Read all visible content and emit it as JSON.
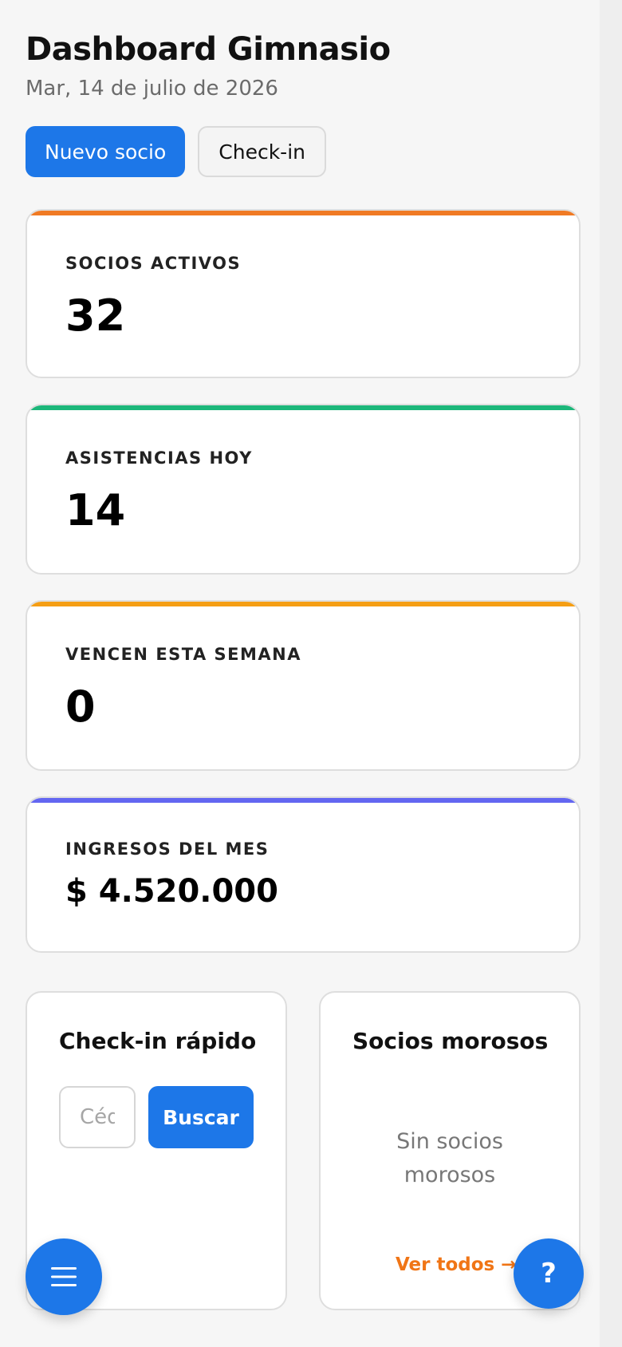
{
  "header": {
    "title": "Dashboard Gimnasio",
    "date": "Mar, 14 de julio de 2026"
  },
  "actions": {
    "new_member": "Nuevo socio",
    "checkin": "Check-in"
  },
  "stats": [
    {
      "label": "SOCIOS ACTIVOS",
      "value": "32",
      "accent": "#f07a24"
    },
    {
      "label": "ASISTENCIAS HOY",
      "value": "14",
      "accent": "#1cb77a"
    },
    {
      "label": "VENCEN ESTA SEMANA",
      "value": "0",
      "accent": "#f59e14"
    },
    {
      "label": "INGRESOS DEL MES",
      "value": "$ 4.520.000",
      "accent": "#6366f1"
    }
  ],
  "quick_checkin": {
    "title": "Check-in rápido",
    "placeholder": "Cédula",
    "search_label": "Buscar"
  },
  "overdue": {
    "title": "Socios morosos",
    "empty": "Sin socios morosos",
    "see_all": "Ver todos →"
  },
  "fab": {
    "menu_icon": "hamburger-menu-icon",
    "help_label": "?"
  },
  "colors": {
    "primary": "#1d77e8",
    "link_orange": "#f07516"
  }
}
